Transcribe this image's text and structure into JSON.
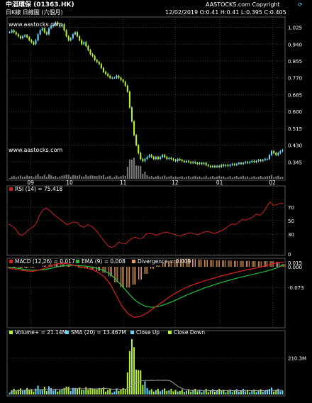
{
  "header": {
    "title": "中滔環保 (01363.HK)",
    "subtitle": "日K線 日線圖 (六個月)",
    "copyright": "AASTOCKS.com Copyright",
    "quote": "12/02/2019  O:0.41  H:0.41  L:0.395  C:0.405",
    "watermark": "www.aastocks.com"
  },
  "colors": {
    "background": "#000000",
    "frame": "#5a5a5a",
    "grid": "#333333",
    "up": "#66d8ff",
    "down": "#b7f22a",
    "volume_bar": "#7a7a7a",
    "volume_line": "#a0a0a0",
    "rsi": "#d02020",
    "macd": "#e02020",
    "ema": "#22c33a",
    "divergence": "#e8a060",
    "vol_up": "#66d8ff",
    "vol_down": "#b7f22a",
    "text": "#ffffff"
  },
  "chart_data": [
    {
      "type": "candlestick",
      "title": "中滔環保 (01363.HK)",
      "xlabel": "",
      "ylabel": "",
      "x_ticks": [
        "09",
        "10",
        "11",
        "12",
        "01",
        "02"
      ],
      "ylim": [
        0.26,
        1.07
      ],
      "y_ticks": [
        0.345,
        0.43,
        0.515,
        0.6,
        0.685,
        0.77,
        0.855,
        0.94,
        1.025
      ],
      "close": [
        1.0,
        1.01,
        1.0,
        0.99,
        0.98,
        0.97,
        0.98,
        0.985,
        0.975,
        0.96,
        0.95,
        0.94,
        0.96,
        0.99,
        1.01,
        1.02,
        1.0,
        0.99,
        1.02,
        1.03,
        1.04,
        1.05,
        1.04,
        1.03,
        1.04,
        1.01,
        0.98,
        0.96,
        0.97,
        0.99,
        1.0,
        0.98,
        0.96,
        0.94,
        0.95,
        0.93,
        0.91,
        0.89,
        0.88,
        0.86,
        0.85,
        0.84,
        0.82,
        0.8,
        0.79,
        0.78,
        0.77,
        0.77,
        0.77,
        0.78,
        0.77,
        0.76,
        0.75,
        0.73,
        0.7,
        0.62,
        0.55,
        0.48,
        0.43,
        0.39,
        0.36,
        0.35,
        0.36,
        0.37,
        0.38,
        0.37,
        0.36,
        0.37,
        0.36,
        0.37,
        0.38,
        0.37,
        0.36,
        0.365,
        0.36,
        0.355,
        0.35,
        0.36,
        0.355,
        0.35,
        0.345,
        0.35,
        0.345,
        0.34,
        0.345,
        0.34,
        0.335,
        0.34,
        0.335,
        0.34,
        0.33,
        0.325,
        0.32,
        0.325,
        0.32,
        0.325,
        0.32,
        0.33,
        0.325,
        0.33,
        0.325,
        0.33,
        0.335,
        0.33,
        0.335,
        0.34,
        0.335,
        0.34,
        0.345,
        0.34,
        0.345,
        0.35,
        0.345,
        0.35,
        0.355,
        0.35,
        0.355,
        0.36,
        0.36,
        0.38,
        0.4,
        0.39,
        0.38,
        0.39,
        0.4,
        0.405
      ],
      "volume_ylim": [
        0,
        350
      ],
      "volume_ticks": [
        "210.3M"
      ]
    },
    {
      "type": "line",
      "title": "RSI (14) = 75.418",
      "ylim": [
        0,
        100
      ],
      "y_ticks": [
        0,
        30,
        50,
        70
      ],
      "series": [
        {
          "name": "RSI (14) = 75.418",
          "values": [
            45,
            42,
            38,
            30,
            28,
            32,
            37,
            40,
            45,
            58,
            66,
            69,
            65,
            60,
            56,
            52,
            48,
            44,
            46,
            48,
            47,
            42,
            40,
            44,
            42,
            38,
            32,
            25,
            18,
            12,
            10,
            12,
            18,
            16,
            15,
            20,
            24,
            25,
            23,
            24,
            30,
            31,
            30,
            28,
            30,
            32,
            33,
            31,
            30,
            28,
            27,
            29,
            31,
            32,
            30,
            29,
            31,
            33,
            34,
            32,
            31,
            33,
            35,
            38,
            42,
            45,
            44,
            48,
            52,
            51,
            53,
            55,
            60,
            58,
            62,
            70,
            78,
            73,
            74,
            76,
            75.418
          ]
        }
      ]
    },
    {
      "type": "line",
      "title": "MACD (12,26) = 0.017",
      "ylim": [
        -0.21,
        0.025
      ],
      "y_ticks": [
        0.015,
        0.0,
        -0.073
      ],
      "series": [
        {
          "name": "MACD (12,26) = 0.017",
          "values": [
            -0.005,
            -0.008,
            -0.012,
            -0.015,
            -0.016,
            -0.012,
            -0.006,
            0.002,
            0.01,
            0.012,
            0.01,
            0.005,
            0.0,
            -0.004,
            -0.01,
            -0.02,
            -0.035,
            -0.06,
            -0.1,
            -0.14,
            -0.165,
            -0.178,
            -0.175,
            -0.165,
            -0.15,
            -0.135,
            -0.12,
            -0.105,
            -0.092,
            -0.08,
            -0.07,
            -0.062,
            -0.055,
            -0.048,
            -0.042,
            -0.036,
            -0.03,
            -0.025,
            -0.02,
            -0.015,
            -0.01,
            -0.006,
            -0.002,
            0.004,
            0.01,
            0.014,
            0.017
          ]
        },
        {
          "name": "EMA (9) = 0.008",
          "values": [
            -0.002,
            -0.004,
            -0.007,
            -0.01,
            -0.012,
            -0.012,
            -0.01,
            -0.006,
            -0.001,
            0.003,
            0.005,
            0.005,
            0.004,
            0.002,
            -0.001,
            -0.006,
            -0.014,
            -0.026,
            -0.045,
            -0.068,
            -0.092,
            -0.115,
            -0.13,
            -0.14,
            -0.143,
            -0.14,
            -0.134,
            -0.126,
            -0.117,
            -0.107,
            -0.098,
            -0.089,
            -0.081,
            -0.073,
            -0.066,
            -0.059,
            -0.053,
            -0.047,
            -0.041,
            -0.036,
            -0.031,
            -0.026,
            -0.021,
            -0.016,
            -0.01,
            -0.003,
            0.008
          ]
        },
        {
          "name": "Divergence = 0.009",
          "type": "bar",
          "values": [
            -0.003,
            -0.004,
            -0.005,
            -0.005,
            -0.004,
            0.0,
            0.004,
            0.008,
            0.011,
            0.009,
            0.005,
            0.0,
            -0.004,
            -0.006,
            -0.009,
            -0.014,
            -0.021,
            -0.034,
            -0.055,
            -0.072,
            -0.073,
            -0.063,
            -0.045,
            -0.025,
            -0.007,
            0.005,
            0.014,
            0.021,
            0.025,
            0.027,
            0.028,
            0.027,
            0.026,
            0.025,
            0.024,
            0.023,
            0.023,
            0.022,
            0.021,
            0.021,
            0.021,
            0.02,
            0.019,
            0.02,
            0.02,
            0.017,
            0.009
          ]
        }
      ]
    },
    {
      "type": "bar",
      "title": "Volume+ = 21.14M",
      "ylim": [
        0,
        350
      ],
      "y_ticks": [
        "210.3M"
      ],
      "legend": [
        "Volume+ = 21.14M",
        "SMA (20) = 13.467M",
        "Close Up",
        "Close Down"
      ]
    }
  ]
}
